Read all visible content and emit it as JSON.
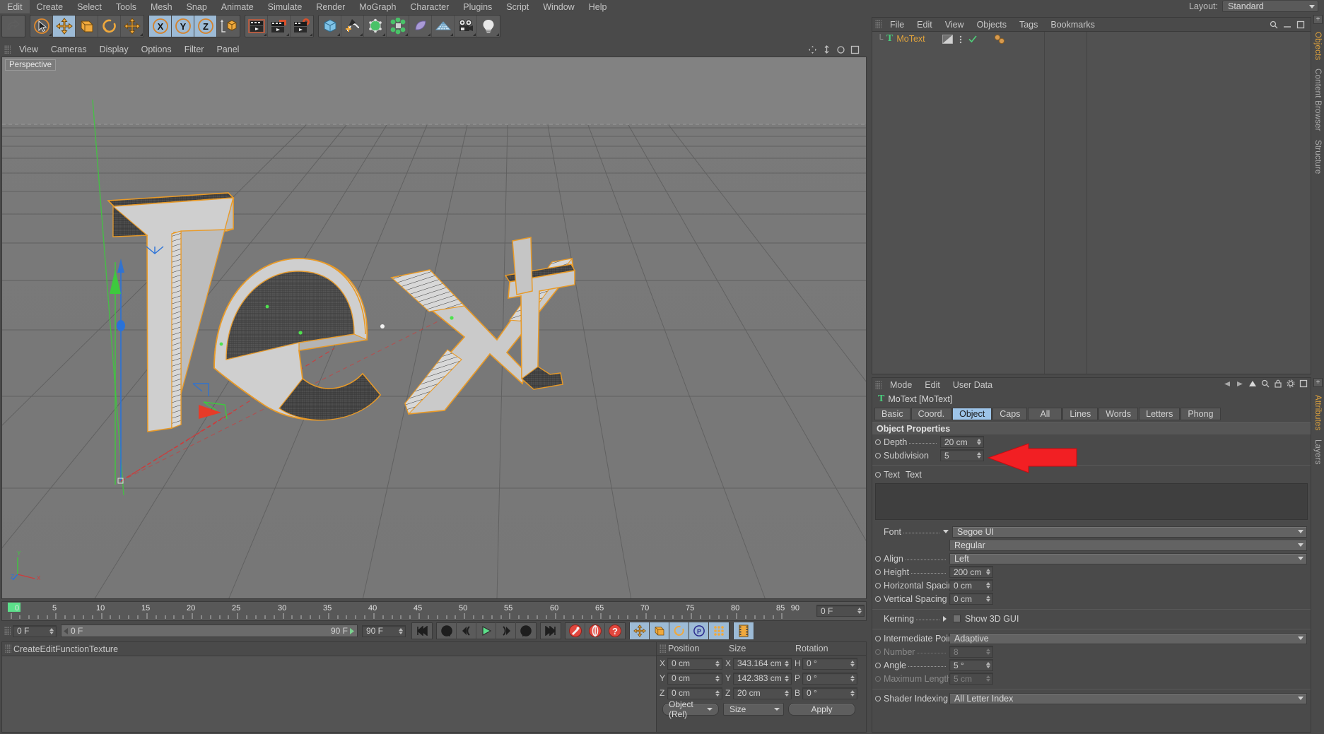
{
  "app": {
    "menubar": [
      "Edit",
      "Create",
      "Select",
      "Tools",
      "Mesh",
      "Snap",
      "Animate",
      "Simulate",
      "Render",
      "MoGraph",
      "Character",
      "Plugins",
      "Script",
      "Window",
      "Help"
    ],
    "layout_label": "Layout:",
    "layout_value": "Standard"
  },
  "toolbar": {
    "groups": [
      {
        "name": "undo-group",
        "buttons": [
          {
            "icon": "undo-icon",
            "selected": false
          }
        ]
      },
      {
        "name": "tool-group",
        "buttons": [
          {
            "icon": "live-selection-icon",
            "selected": false
          },
          {
            "icon": "move-icon",
            "selected": true
          },
          {
            "icon": "scale-icon",
            "selected": false
          },
          {
            "icon": "rotate-icon",
            "selected": false
          },
          {
            "icon": "move-tool-icon",
            "selected": false
          }
        ]
      },
      {
        "name": "axis-group",
        "buttons": [
          {
            "icon": "x-axis-icon",
            "selected": true
          },
          {
            "icon": "y-axis-icon",
            "selected": true
          },
          {
            "icon": "z-axis-icon",
            "selected": true
          },
          {
            "icon": "world-object-icon",
            "selected": false
          }
        ]
      },
      {
        "name": "render-group",
        "buttons": [
          {
            "icon": "render-view-icon",
            "selected": false
          },
          {
            "icon": "render-picture-viewer-icon",
            "selected": false
          },
          {
            "icon": "render-settings-icon",
            "selected": false
          }
        ]
      },
      {
        "name": "object-group",
        "buttons": [
          {
            "icon": "cube-primitive-icon",
            "selected": false
          },
          {
            "icon": "spline-pen-icon",
            "selected": false
          },
          {
            "icon": "generator-icon",
            "selected": false
          },
          {
            "icon": "mograph-icon",
            "selected": false
          },
          {
            "icon": "deformer-icon",
            "selected": false
          },
          {
            "icon": "floor-environment-icon",
            "selected": false
          },
          {
            "icon": "camera-icon",
            "selected": false
          },
          {
            "icon": "light-icon",
            "selected": false
          }
        ]
      }
    ]
  },
  "viewport": {
    "menu": [
      "View",
      "Cameras",
      "Display",
      "Options",
      "Filter",
      "Panel"
    ],
    "label": "Perspective",
    "scene_text": "Text",
    "axis_labels": [
      "Y",
      "Z",
      "X"
    ]
  },
  "timeline": {
    "ticks": [
      "0",
      "5",
      "10",
      "15",
      "20",
      "25",
      "30",
      "35",
      "40",
      "45",
      "50",
      "55",
      "60",
      "65",
      "70",
      "75",
      "80",
      "85",
      "90"
    ],
    "current_frame": "0 F",
    "range_start": "0 F",
    "range_end": "90 F",
    "preview_min": "0 F",
    "preview_max": "90 F",
    "max_frame": "90 F"
  },
  "transport": {
    "buttons": [
      "go-to-start-icon",
      "go-back-keyframe-icon",
      "step-back-icon",
      "play-icon",
      "step-forward-icon",
      "loop-icon",
      "go-to-end-icon"
    ],
    "record_buttons": [
      "record-active-objects-icon",
      "autokeying-icon",
      "keyframe-selection-icon"
    ],
    "axis_buttons": [
      "position-key-icon",
      "scale-key-icon",
      "rotation-key-icon",
      "parameter-key-icon",
      "point-level-animation-icon"
    ],
    "extra_buttons": [
      "timeline-icon"
    ]
  },
  "materials": {
    "menu": [
      "Create",
      "Edit",
      "Function",
      "Texture"
    ]
  },
  "coordinates": {
    "headers": [
      "Position",
      "Size",
      "Rotation"
    ],
    "rows": [
      {
        "plabel": "X",
        "position": "0 cm",
        "slabel": "X",
        "size": "343.164 cm",
        "rlabel": "H",
        "rotation": "0 °"
      },
      {
        "plabel": "Y",
        "position": "0 cm",
        "slabel": "Y",
        "size": "142.383 cm",
        "rlabel": "P",
        "rotation": "0 °"
      },
      {
        "plabel": "Z",
        "position": "0 cm",
        "slabel": "Z",
        "size": "20 cm",
        "rlabel": "B",
        "rotation": "0 °"
      }
    ],
    "mode_value": "Object (Rel)",
    "size_value": "Size",
    "apply_label": "Apply"
  },
  "object_manager": {
    "menu": [
      "File",
      "Edit",
      "View",
      "Objects",
      "Tags",
      "Bookmarks"
    ],
    "object_name": "MoText",
    "object_icon": "motext-icon",
    "tags": [
      "phong-tag-icon",
      "mograph-tag-icon"
    ]
  },
  "attributes": {
    "menu": [
      "Mode",
      "Edit",
      "User Data"
    ],
    "object_title": "MoText [MoText]",
    "tabs": [
      {
        "label": "Basic",
        "selected": false
      },
      {
        "label": "Coord.",
        "selected": false
      },
      {
        "label": "Object",
        "selected": true
      },
      {
        "label": "Caps",
        "selected": false
      },
      {
        "label": "All",
        "selected": false
      },
      {
        "label": "Lines",
        "selected": false
      },
      {
        "label": "Words",
        "selected": false
      },
      {
        "label": "Letters",
        "selected": false
      },
      {
        "label": "Phong",
        "selected": false
      }
    ],
    "section_title": "Object Properties",
    "depth_label": "Depth",
    "depth_value": "20 cm",
    "subdivision_label": "Subdivision",
    "subdivision_value": "5",
    "text_label": "Text",
    "text_value": "Text",
    "font_label": "Font",
    "font_value": "Segoe UI",
    "font_style_value": "Regular",
    "align_label": "Align",
    "align_value": "Left",
    "height_label": "Height",
    "height_value": "200 cm",
    "hspacing_label": "Horizontal Spacing",
    "hspacing_value": "0 cm",
    "vspacing_label": "Vertical Spacing",
    "vspacing_value": "0 cm",
    "kerning_label": "Kerning",
    "show3dgui_label": "Show 3D GUI",
    "show3dgui_checked": false,
    "intermediate_label": "Intermediate Points",
    "intermediate_value": "Adaptive",
    "number_label": "Number",
    "number_value": "8",
    "angle_label": "Angle",
    "angle_value": "5 °",
    "maxlength_label": "Maximum Length",
    "maxlength_value": "5 cm",
    "shader_label": "Shader Indexing",
    "shader_value": "All Letter Index"
  },
  "side_tabs": {
    "top": [
      {
        "label": "Objects",
        "selected": true
      },
      {
        "label": "Content Browser",
        "selected": false
      },
      {
        "label": "Structure",
        "selected": false
      }
    ],
    "bottom": [
      {
        "label": "Attributes",
        "selected": true
      },
      {
        "label": "Layers",
        "selected": false
      }
    ]
  },
  "annotation": {
    "type": "red-arrow-left",
    "color": "#ee1c25",
    "points_at": "subdivision-field"
  }
}
